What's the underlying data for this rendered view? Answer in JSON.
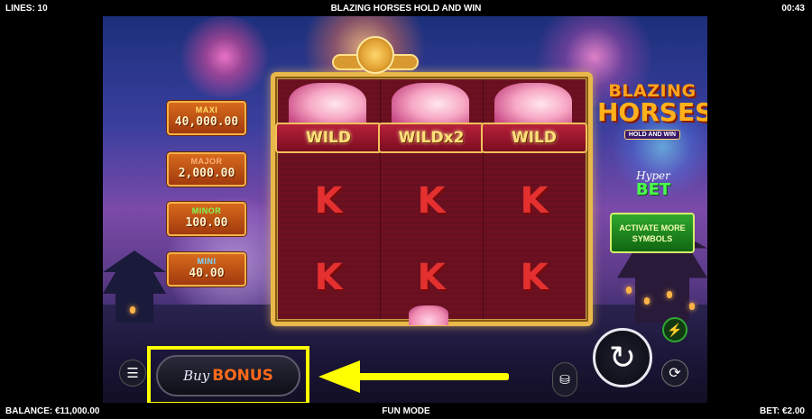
{
  "top_bar": {
    "lines": "LINES: 10",
    "title": "BLAZING HORSES HOLD AND WIN",
    "clock": "00:43"
  },
  "bottom_bar": {
    "balance": "BALANCE: €11,000.00",
    "mode": "FUN MODE",
    "bet": "BET: €2.00"
  },
  "jackpots": [
    {
      "name": "MAXI",
      "amount": "40,000.00",
      "name_color": "#ffe066"
    },
    {
      "name": "MAJOR",
      "amount": "2,000.00",
      "name_color": "#ff8a3a"
    },
    {
      "name": "MINOR",
      "amount": "100.00",
      "name_color": "#7dff5a"
    },
    {
      "name": "MINI",
      "amount": "40.00",
      "name_color": "#7ad8ff"
    }
  ],
  "reels": [
    {
      "wild_label": "WILD",
      "symbols": [
        "K",
        "K"
      ]
    },
    {
      "wild_label": "WILDx2",
      "symbols": [
        "K",
        "K"
      ]
    },
    {
      "wild_label": "WILD",
      "symbols": [
        "K",
        "K"
      ]
    }
  ],
  "logo": {
    "line1": "BLAZING",
    "line2": "HORSES",
    "line3": "HOLD AND WIN"
  },
  "hyper_bet": {
    "line1": "Hyper",
    "line2": "BET"
  },
  "activate_button": "ACTIVATE MORE SYMBOLS",
  "buy_bonus": {
    "buy": "Buy",
    "bonus": "BONUS"
  },
  "icons": {
    "menu": "hamburger-menu-icon",
    "coins": "coin-stack-icon",
    "spin": "spin-arrow-icon",
    "autoplay": "autoplay-icon",
    "turbo": "lightning-icon"
  },
  "colors": {
    "highlight": "#ffff00",
    "accent": "#ff6a1a",
    "frame_gold": "#e9b84a"
  }
}
